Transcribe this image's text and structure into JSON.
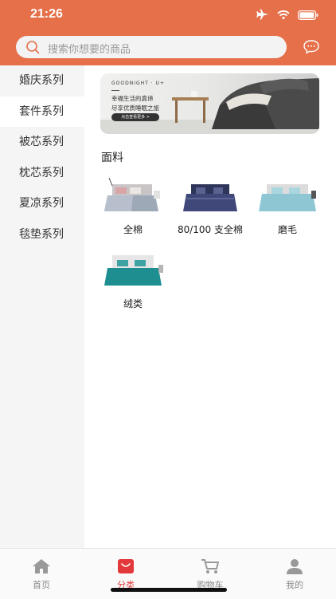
{
  "status_bar": {
    "time": "21:26"
  },
  "search": {
    "placeholder": "搜索你想要的商品"
  },
  "sidebar": {
    "items": [
      {
        "label": "婚庆系列"
      },
      {
        "label": "套件系列"
      },
      {
        "label": "被芯系列"
      },
      {
        "label": "枕芯系列"
      },
      {
        "label": "夏凉系列"
      },
      {
        "label": "毯垫系列"
      }
    ],
    "active_index": 1
  },
  "banner": {
    "title": "GOODNIGHT · U+",
    "line1": "幸福生活的真谛",
    "line2": "尽享优质睡眠之旅",
    "button": "点击查看更多 >"
  },
  "section": {
    "title": "面料"
  },
  "products": [
    {
      "name": "全棉"
    },
    {
      "name": "80/100 支全棉"
    },
    {
      "name": "磨毛"
    },
    {
      "name": "绒类"
    }
  ],
  "tabbar": {
    "items": [
      {
        "label": "首页",
        "icon": "home-icon"
      },
      {
        "label": "分类",
        "icon": "category-bag-icon"
      },
      {
        "label": "购物车",
        "icon": "cart-icon"
      },
      {
        "label": "我的",
        "icon": "user-icon"
      }
    ],
    "active_index": 1
  },
  "colors": {
    "brand": "#e5704a",
    "active_tab": "#e4393c"
  }
}
